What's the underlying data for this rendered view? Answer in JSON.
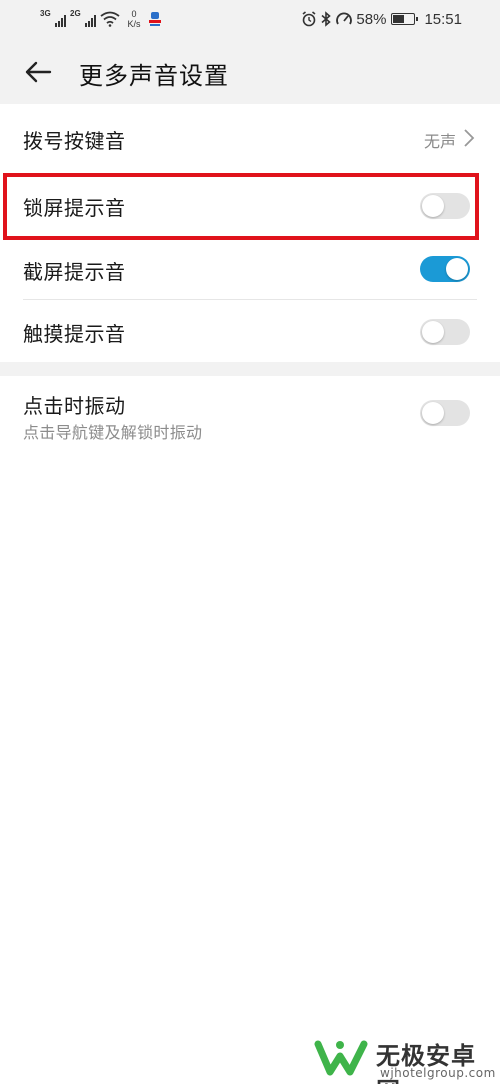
{
  "status_bar": {
    "sim1_tag": "3G",
    "sim2_tag": "2G",
    "net_speed_value": "0",
    "net_speed_unit": "K/s",
    "battery_percent": "58%",
    "battery_level": 0.58,
    "time": "15:51"
  },
  "header": {
    "title": "更多声音设置"
  },
  "settings": {
    "dial_pad": {
      "label": "拨号按键音",
      "value": "无声"
    },
    "lock_screen": {
      "label": "锁屏提示音",
      "enabled": false
    },
    "screenshot": {
      "label": "截屏提示音",
      "enabled": true
    },
    "touch": {
      "label": "触摸提示音",
      "enabled": false
    },
    "vibrate": {
      "label": "点击时振动",
      "sublabel": "点击导航键及解锁时振动",
      "enabled": false
    }
  },
  "colors": {
    "accent": "#1b9ad6",
    "highlight": "#e0121b",
    "toggle_off": "#e3e3e3",
    "background_gray": "#f2f2f2"
  },
  "watermark": {
    "name": "无极安卓网",
    "url": "wjhotelgroup.com"
  }
}
